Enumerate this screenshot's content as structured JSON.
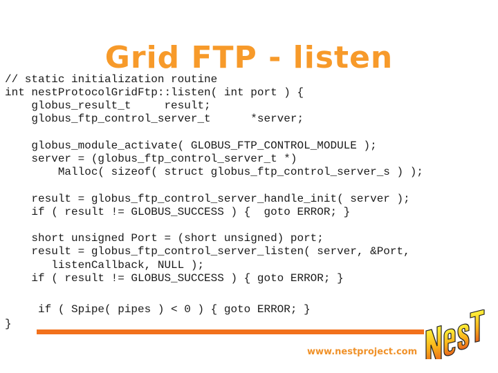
{
  "slide": {
    "title": "Grid FTP - listen",
    "code_lines": [
      {
        "text": "// static initialization routine"
      },
      {
        "text": "int nestProtocolGridFtp::listen( int port ) {"
      },
      {
        "text": "    globus_result_t     result;"
      },
      {
        "text": "    globus_ftp_control_server_t      *server;"
      },
      {
        "text": ""
      },
      {
        "text": "    globus_module_activate( GLOBUS_FTP_CONTROL_MODULE );"
      },
      {
        "text": "    server = (globus_ftp_control_server_t *)"
      },
      {
        "text": "        Malloc( sizeof( struct globus_ftp_control_server_s ) );"
      },
      {
        "text": ""
      },
      {
        "text": "    result = globus_ftp_control_server_handle_init( server );"
      },
      {
        "text": "    if ( result != GLOBUS_SUCCESS ) {  goto ERROR; }"
      },
      {
        "text": ""
      },
      {
        "text": "    short unsigned Port = (short unsigned) port;"
      },
      {
        "text": "    result = globus_ftp_control_server_listen( server, &Port,"
      },
      {
        "text": "       listenCallback, NULL );"
      },
      {
        "text": "    if ( result != GLOBUS_SUCCESS ) { goto ERROR; }"
      },
      {
        "text": ""
      },
      {
        "text": ""
      },
      {
        "text": "     if ( Spipe( pipes ) < 0 ) { goto ERROR; }"
      },
      {
        "text": "}"
      }
    ],
    "footer": {
      "url": "www.nestproject.com",
      "logo_text": "NeST",
      "accent_color": "#f2711c",
      "title_color": "#f79a2a"
    }
  }
}
